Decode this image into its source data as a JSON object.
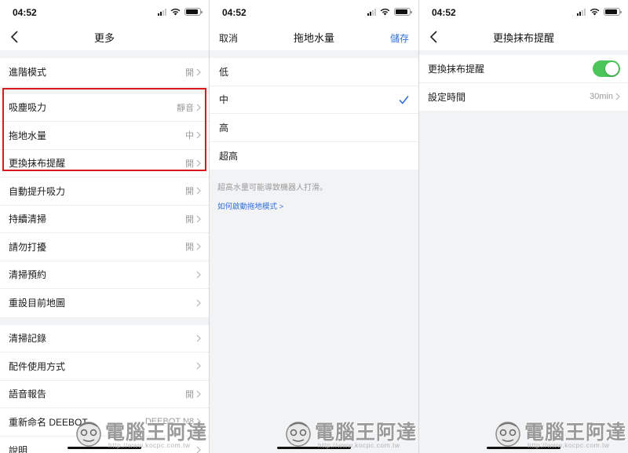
{
  "status_time": "04:52",
  "panel1": {
    "title": "更多",
    "groups": [
      [
        {
          "label": "進階模式",
          "value": "開"
        }
      ],
      [
        {
          "label": "吸塵吸力",
          "value": "靜音"
        },
        {
          "label": "拖地水量",
          "value": "中"
        },
        {
          "label": "更換抹布提醒",
          "value": "開"
        },
        {
          "label": "自動提升吸力",
          "value": "開"
        },
        {
          "label": "持續清掃",
          "value": "開"
        },
        {
          "label": "請勿打擾",
          "value": "開"
        },
        {
          "label": "清掃預約",
          "value": ""
        },
        {
          "label": "重設目前地圖",
          "value": ""
        }
      ],
      [
        {
          "label": "清掃記錄",
          "value": ""
        },
        {
          "label": "配件使用方式",
          "value": ""
        },
        {
          "label": "語音報告",
          "value": "開"
        },
        {
          "label": "重新命名 DEEBOT",
          "value": "DEEBOT N8"
        },
        {
          "label": "說明",
          "value": ""
        }
      ]
    ]
  },
  "panel2": {
    "cancel": "取消",
    "title": "拖地水量",
    "save": "儲存",
    "options": [
      "低",
      "中",
      "高",
      "超高"
    ],
    "selected": "中",
    "note": "超高水量可能導致機器人打滑。",
    "link": "如何啟動拖地模式 >"
  },
  "panel3": {
    "title": "更換抹布提醒",
    "toggle_label": "更換抹布提醒",
    "toggle_on": true,
    "time_label": "設定時間",
    "time_value": "30min"
  },
  "watermark": {
    "brand": "電腦王阿達",
    "url": "http://www.kocpc.com.tw"
  },
  "colors": {
    "accent": "#2f6fd6",
    "toggle_on": "#4cc55a",
    "highlight_box": "#d9191c"
  }
}
